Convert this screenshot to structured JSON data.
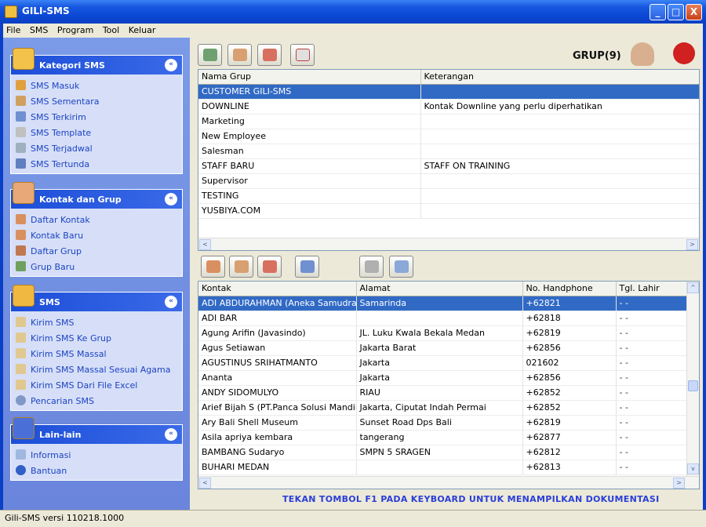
{
  "window": {
    "title": "GILI-SMS",
    "min_label": "_",
    "max_label": "□",
    "close_label": "X"
  },
  "menu": [
    "File",
    "SMS",
    "Program",
    "Tool",
    "Keluar"
  ],
  "sidebar": {
    "collapse_glyph": "«",
    "groups": [
      {
        "title": "Kategori SMS",
        "items": [
          "SMS Masuk",
          "SMS Sementara",
          "SMS Terkirim",
          "SMS Template",
          "SMS Terjadwal",
          "SMS Tertunda"
        ]
      },
      {
        "title": "Kontak dan Grup",
        "items": [
          "Daftar Kontak",
          "Kontak Baru",
          "Daftar Grup",
          "Grup Baru"
        ]
      },
      {
        "title": "SMS",
        "items": [
          "Kirim SMS",
          "Kirim SMS Ke Grup",
          "Kirim SMS Massal",
          "Kirim SMS Massal Sesuai Agama",
          "Kirim SMS Dari File Excel",
          "Pencarian SMS"
        ]
      },
      {
        "title": "Lain-lain",
        "items": [
          "Informasi",
          "Bantuan"
        ]
      }
    ]
  },
  "grup": {
    "title": "GRUP(9)",
    "columns": [
      "Nama Grup",
      "Keterangan"
    ],
    "rows": [
      [
        "CUSTOMER GILI-SMS",
        ""
      ],
      [
        "DOWNLINE",
        "Kontak Downline yang perlu diperhatikan"
      ],
      [
        "Marketing",
        ""
      ],
      [
        "New Employee",
        ""
      ],
      [
        "Salesman",
        ""
      ],
      [
        "STAFF BARU",
        "STAFF ON TRAINING"
      ],
      [
        "Supervisor",
        ""
      ],
      [
        "TESTING",
        ""
      ],
      [
        "YUSBIYA.COM",
        ""
      ]
    ],
    "selected": 0
  },
  "kontak": {
    "columns": [
      "Kontak",
      "Alamat",
      "No. Handphone",
      "Tgl. Lahir"
    ],
    "rows": [
      [
        "ADI ABDURAHMAN (Aneka Samudra",
        "Samarinda",
        "+62821",
        "- -"
      ],
      [
        "ADI BAR",
        "",
        "+62818",
        "- -"
      ],
      [
        "Agung Arifin (Javasindo)",
        "JL. Luku Kwala Bekala Medan",
        "+62819",
        "- -"
      ],
      [
        "Agus Setiawan",
        "Jakarta Barat",
        "+62856",
        "- -"
      ],
      [
        "AGUSTINUS SRIHATMANTO",
        "Jakarta",
        "021602",
        "- -"
      ],
      [
        "Ananta",
        "Jakarta",
        "+62856",
        "- -"
      ],
      [
        "ANDY SIDOMULYO",
        "RIAU",
        "+62852",
        "- -"
      ],
      [
        "Arief Bijah S (PT.Panca Solusi Mandiri)",
        "Jakarta, Ciputat Indah Permai",
        "+62852",
        "- -"
      ],
      [
        "Ary Bali Shell Museum",
        "Sunset Road Dps Bali",
        "+62819",
        "- -"
      ],
      [
        "Asila apriya kembara",
        "tangerang",
        "+62877",
        "- -"
      ],
      [
        "BAMBANG Sudaryo",
        "SMPN 5 SRAGEN",
        "+62812",
        "- -"
      ],
      [
        "BUHARI MEDAN",
        "",
        "+62813",
        "- -"
      ]
    ],
    "selected": 0
  },
  "footer_message": "TEKAN TOMBOL F1 PADA KEYBOARD UNTUK MENAMPILKAN DOKUMENTASI",
  "status": "Gili-SMS versi 110218.1000",
  "scroll": {
    "left": "<",
    "right": ">",
    "up": "^",
    "down": "v"
  }
}
